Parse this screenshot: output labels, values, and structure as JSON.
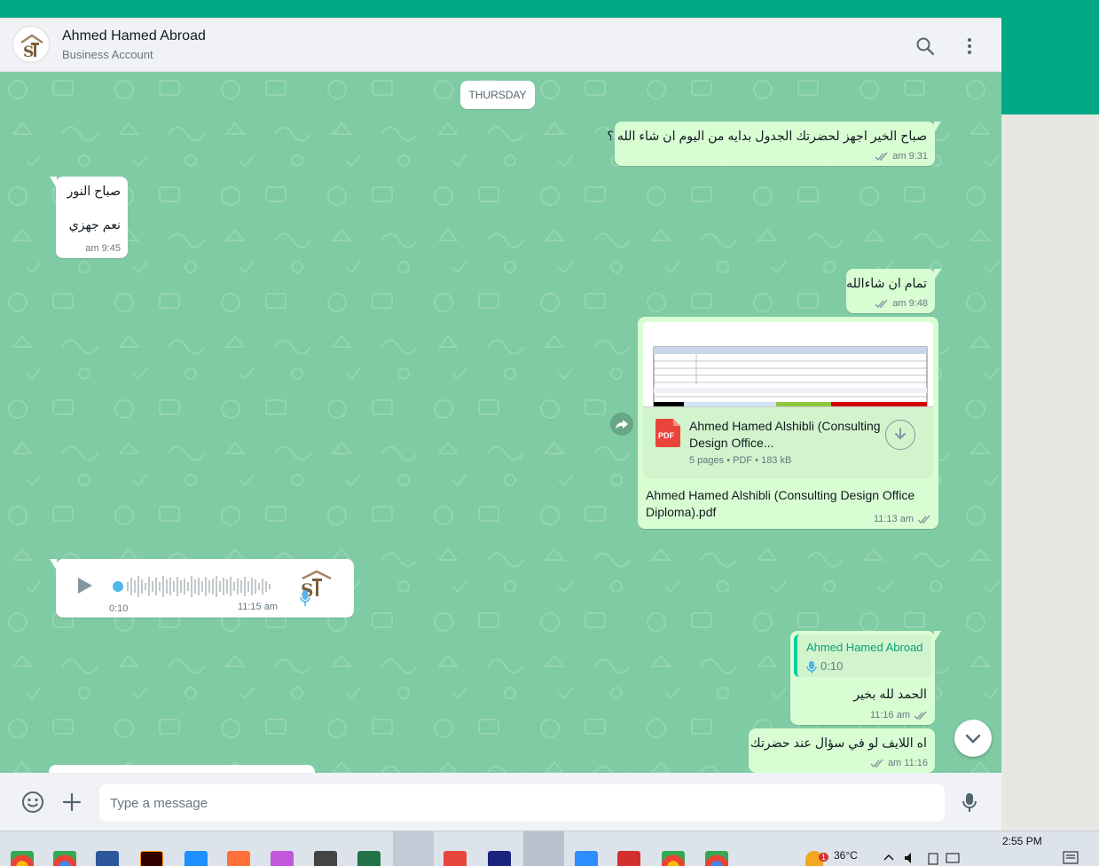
{
  "chat": {
    "contact_name": "Ahmed Hamed Abroad",
    "contact_subtitle": "Business Account",
    "date_label": "THURSDAY"
  },
  "messages": [
    {
      "dir": "out",
      "text": "صباح الخير اجهز لحضرتك الجدول بدايه من اليوم ان شاء الله ؟",
      "time": "9:31 am"
    },
    {
      "dir": "in",
      "line1": "صباح النور",
      "line2": "نعم جهزي",
      "time": "9:45 am"
    },
    {
      "dir": "out",
      "text": "تمام ان شاءالله",
      "time": "9:48 am"
    },
    {
      "dir": "out",
      "type": "document",
      "file_title": "Ahmed Hamed Alshibli (Consulting Design Office...",
      "file_icon": "PDF",
      "file_info": "5 pages • PDF • 183 kB",
      "caption": "Ahmed Hamed Alshibli (Consulting Design Office Diploma).pdf",
      "time": "11:13 am"
    },
    {
      "dir": "in",
      "type": "voice",
      "duration": "0:10",
      "time": "11:15 am"
    },
    {
      "dir": "out",
      "type": "reply",
      "quote_name": "Ahmed Hamed Abroad",
      "quote_duration": "0:10",
      "text": "الحمد لله بخير",
      "time": "11:16 am"
    },
    {
      "dir": "out",
      "text": "اه اللايف لو في سؤال عند حضرتك",
      "time": "11:16 am"
    }
  ],
  "composer": {
    "placeholder": "Type a message"
  },
  "taskbar": {
    "temperature": "36°C",
    "clock": "2:55 PM",
    "weather_badge": "1"
  },
  "colors": {
    "accent": "#00a884",
    "chat_bg": "#7fcba3",
    "outgoing_bubble": "#d9fdd3",
    "incoming_bubble": "#ffffff",
    "read_ticks": "#8696a0"
  },
  "icons": [
    "search-icon",
    "menu-icon",
    "emoji-icon",
    "plus-icon",
    "mic-icon",
    "forward-icon",
    "download-icon",
    "play-icon",
    "chevron-down-icon",
    "pdf-icon",
    "double-check-icon"
  ]
}
